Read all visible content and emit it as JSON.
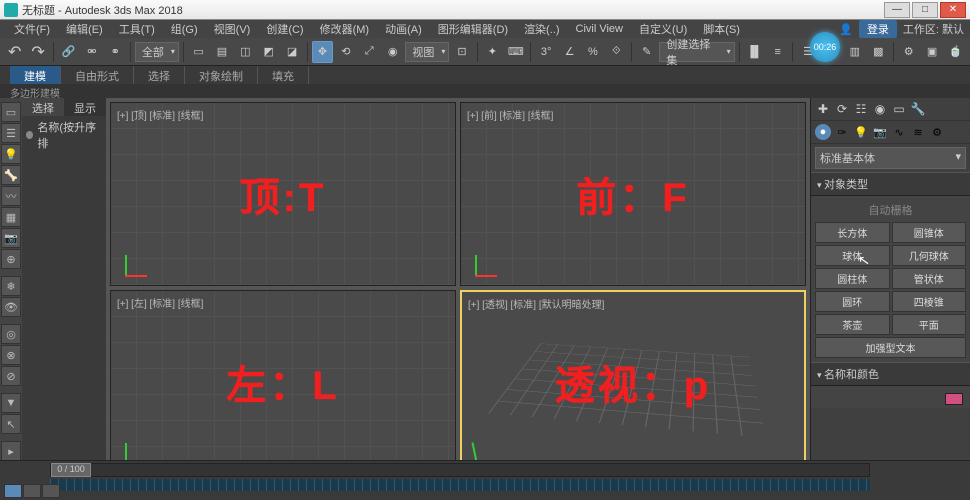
{
  "title": "无标题 - Autodesk 3ds Max 2018",
  "menu": {
    "file": "文件(F)",
    "edit": "编辑(E)",
    "tools": "工具(T)",
    "group": "组(G)",
    "views": "视图(V)",
    "create": "创建(C)",
    "modifiers": "修改器(M)",
    "animation": "动画(A)",
    "graph": "图形编辑器(D)",
    "render": "渲染(..)",
    "civil": "Civil View",
    "customize": "自定义(U)",
    "script": "脚本(S)",
    "login": "登录",
    "workspace": "工作区: 默认"
  },
  "toolbar": {
    "all": "全部",
    "view": "视图",
    "createsel": "创建选择集"
  },
  "clock": "00:26",
  "ribbon": {
    "tabs": [
      "建模",
      "自由形式",
      "选择",
      "对象绘制",
      "填充"
    ],
    "sub": "多边形建模"
  },
  "scene": {
    "tabs": [
      "选择",
      "显示"
    ],
    "row": "名称(按升序排"
  },
  "viewports": {
    "top": {
      "lbl": "[+] [顶] [标准] [线框]",
      "big": "顶:T"
    },
    "front": {
      "lbl": "[+] [前] [标准] [线框]",
      "big": "前：F"
    },
    "left": {
      "lbl": "[+] [左] [标准] [线框]",
      "big": "左：L"
    },
    "persp": {
      "lbl": "[+] [透视] [标准] [默认明暗处理]",
      "big": "透视：p"
    }
  },
  "cmd": {
    "dd": "标准基本体",
    "roll1": "对象类型",
    "autogrid": "自动栅格",
    "buttons": [
      "长方体",
      "圆锥体",
      "球体",
      "几何球体",
      "圆柱体",
      "管状体",
      "圆环",
      "四棱锥",
      "茶壶",
      "平面",
      "加强型文本"
    ],
    "roll2": "名称和颜色"
  },
  "time": {
    "handle": "0 / 100"
  }
}
